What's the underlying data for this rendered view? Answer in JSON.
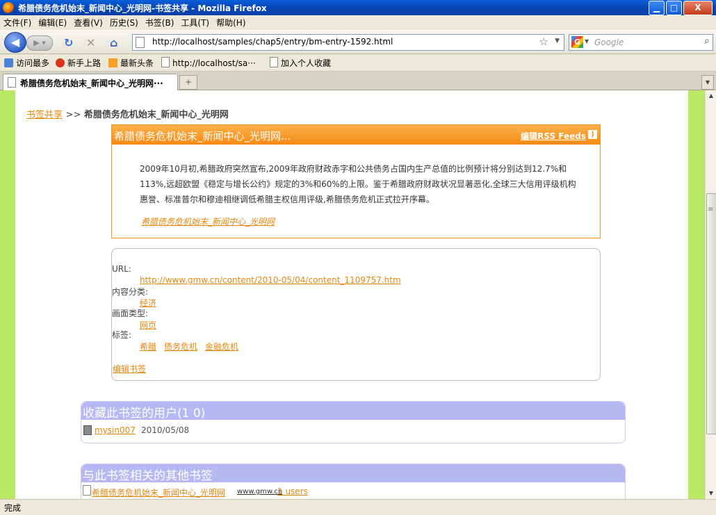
{
  "window": {
    "title": "希腊债务危机始末_新闻中心_光明网-书签共享 - Mozilla Firefox",
    "minimize": "▁",
    "maximize": "□",
    "close": "X"
  },
  "menu": [
    "文件(F)",
    "编辑(E)",
    "查看(V)",
    "历史(S)",
    "书签(B)",
    "工具(T)",
    "帮助(H)"
  ],
  "nav": {
    "url": "http://localhost/samples/chap5/entry/bm-entry-1592.html",
    "search_placeholder": "Google"
  },
  "bookmarks_bar": [
    "访问最多",
    "新手上路",
    "最新头条",
    "http://localhost/sa···",
    "加入个人收藏"
  ],
  "tab": {
    "title": "希腊债务危机始末_新闻中心_光明网···"
  },
  "page": {
    "breadcrumb_link": "书签共享",
    "breadcrumb_sep": ">>",
    "breadcrumb_current": "希腊债务危机始末_新闻中心_光明网",
    "entry": {
      "title": "希腊债务危机始末_新闻中心_光明网...",
      "rss_label": "编辑RSS Feeds",
      "description": "2009年10月初,希腊政府突然宣布,2009年政府财政赤字和公共债务占国内生产总值的比例预计将分别达到12.7%和113%,远超欧盟《稳定与增长公约》规定的3%和60%的上限。鉴于希腊政府财政状况显著恶化,全球三大信用评级机构惠誉、标准普尔和穆迪相继调低希腊主权信用评级,希腊债务危机正式拉开序幕。",
      "source_link": "希腊债务危机始末_新闻中心_光明网"
    },
    "details": {
      "url_label": "URL:",
      "url": "http://www.gmw.cn/content/2010-05/04/content_1109757.htm",
      "category_label": "内容分类:",
      "category": "经济",
      "page_type_label": "画面类型:",
      "page_type": "网页",
      "tags_label": "标签:",
      "tags": [
        "希腊",
        "债务危机",
        "金融危机"
      ],
      "edit_link": "编辑书签"
    },
    "users_section": {
      "title": "收藏此书签的用户(1 0)",
      "users": [
        {
          "name": "mysin007",
          "date": "2010/05/08"
        }
      ]
    },
    "related_section": {
      "title": "与此书签相关的其他书签",
      "items": [
        {
          "title": "希腊债务危机始末_新闻中心_光明网",
          "domain": "www.gmw.cn",
          "users": "1 users"
        }
      ]
    }
  },
  "status": "完成",
  "colors": {
    "accent_orange": "#f7941d",
    "link_orange": "#e8860e",
    "lavender_header": "#b6b8f3",
    "green_stripe": "#b8e865"
  }
}
